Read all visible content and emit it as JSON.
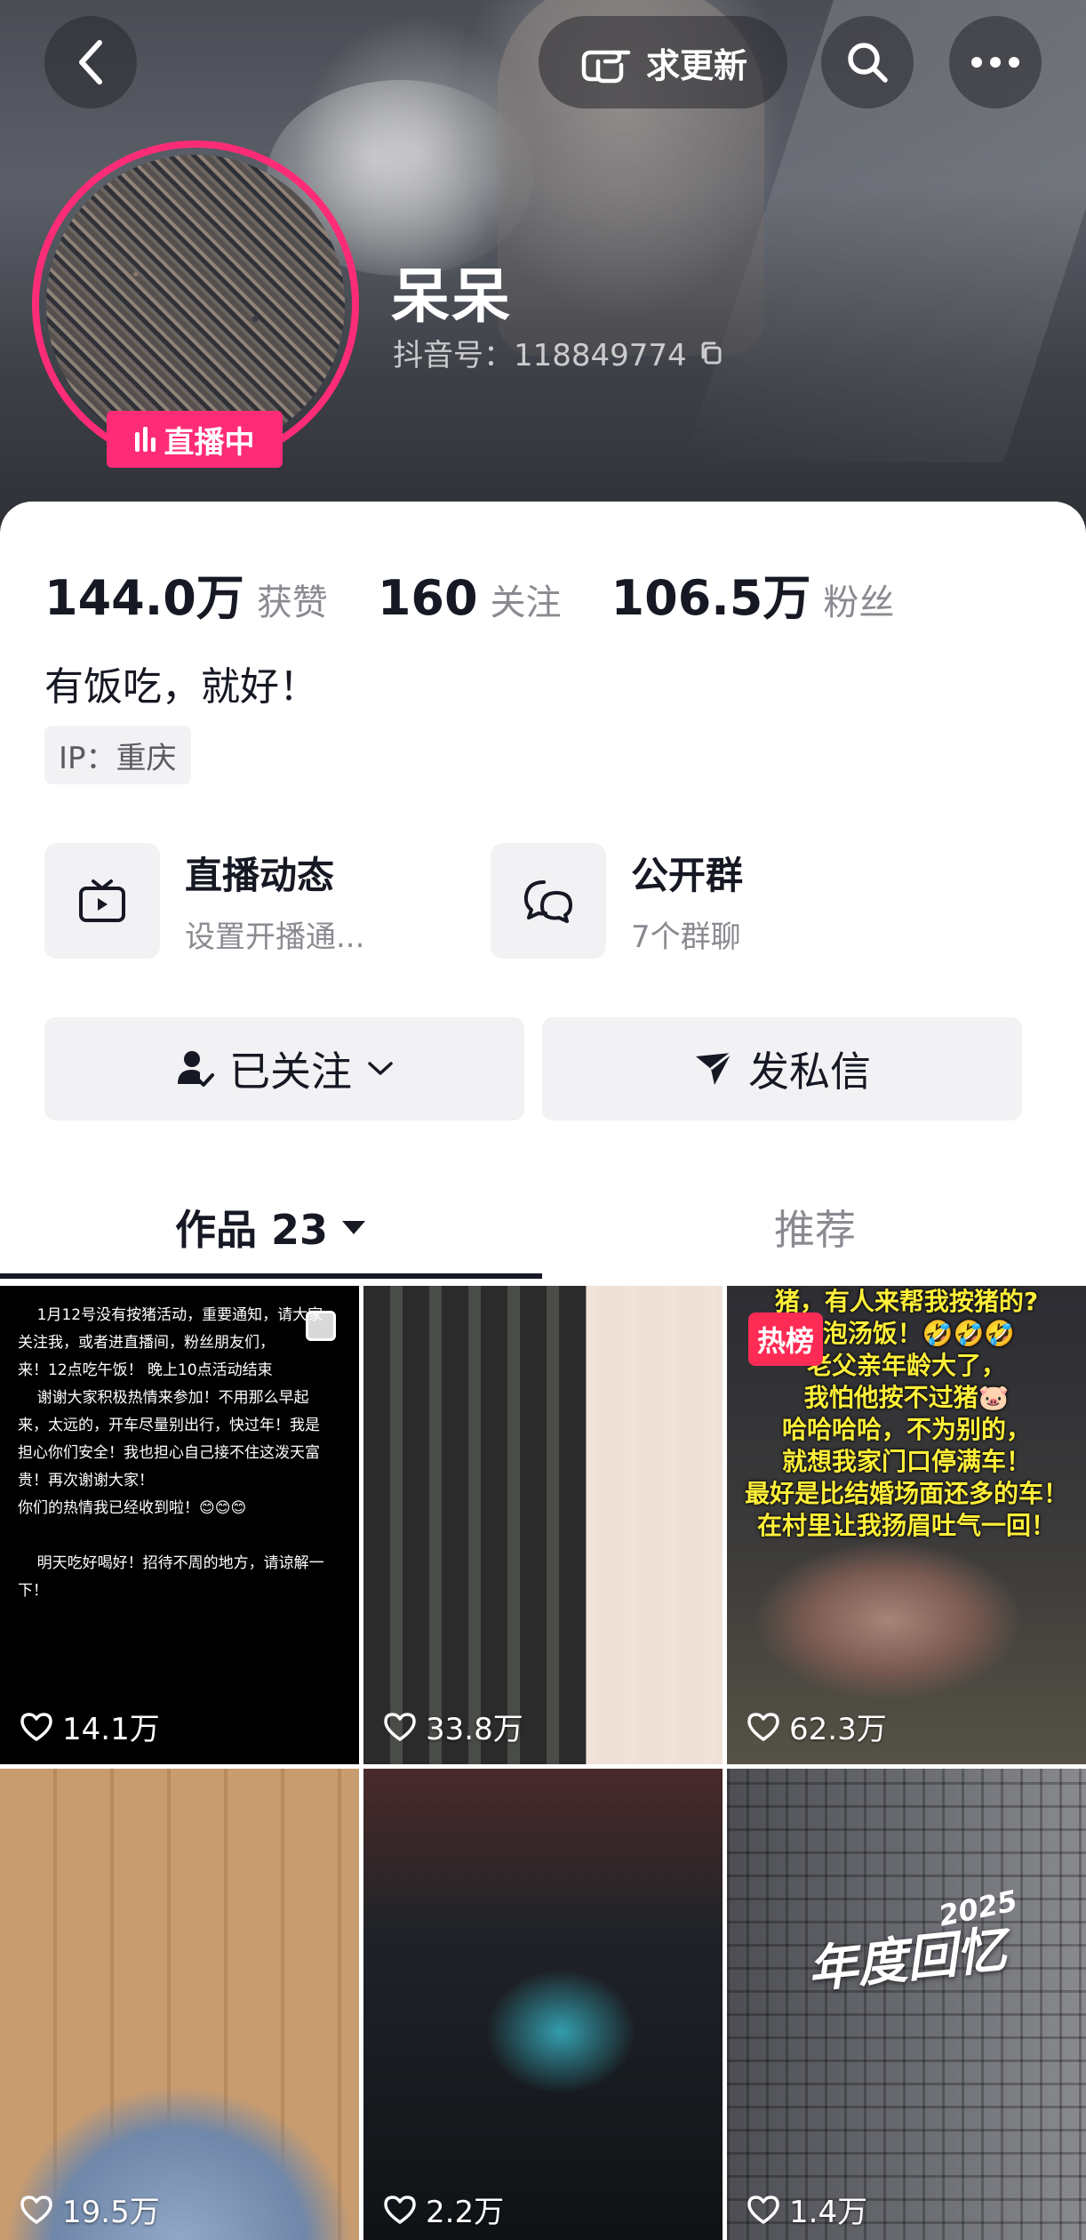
{
  "header": {
    "update_label": "求更新"
  },
  "profile": {
    "name": "呆呆",
    "douyin_id": "抖音号：118849774",
    "live_badge": "直播中",
    "bio": "有饭吃，就好！",
    "ip": "IP：重庆"
  },
  "stats": [
    {
      "value": "144.0万",
      "label": "获赞"
    },
    {
      "value": "160",
      "label": "关注"
    },
    {
      "value": "106.5万",
      "label": "粉丝"
    }
  ],
  "features": {
    "live": {
      "title": "直播动态",
      "subtitle": "设置开播通..."
    },
    "group": {
      "title": "公开群",
      "subtitle": "7个群聊"
    }
  },
  "actions": {
    "follow": "已关注",
    "message": "发私信"
  },
  "tabs": {
    "works": "作品 23",
    "recommend": "推荐"
  },
  "videos": [
    {
      "likes": "14.1万",
      "caption": "    1月12号没有按猪活动，重要通知，请大家\n关注我，或者进直播间，粉丝朋友们，\n来！12点吃午饭！ 晚上10点活动结束\n    谢谢大家积极热情来参加！不用那么早起\n来，太远的，开车尽量别出行，快过年！我是\n担心你们安全！我也担心自己接不住这泼天富\n贵！再次谢谢大家！\n你们的热情我已经收到啦！😊😊😊\n\n    明天吃好喝好！招待不周的地方，请谅解一\n下！"
    },
    {
      "likes": "33.8万"
    },
    {
      "likes": "62.3万",
      "badge": "热榜",
      "caption": "猪，有人来帮我按猪的?\n吃泡汤饭！🤣🤣🤣\n老父亲年龄大了，\n我怕他按不过猪🐷\n哈哈哈哈，不为别的，\n就想我家门口停满车！\n最好是比结婚场面还多的车！\n在村里让我扬眉吐气一回！"
    },
    {
      "likes": "19.5万"
    },
    {
      "likes": "2.2万"
    },
    {
      "likes": "1.4万",
      "title": "年度回忆",
      "year": "2025"
    }
  ]
}
